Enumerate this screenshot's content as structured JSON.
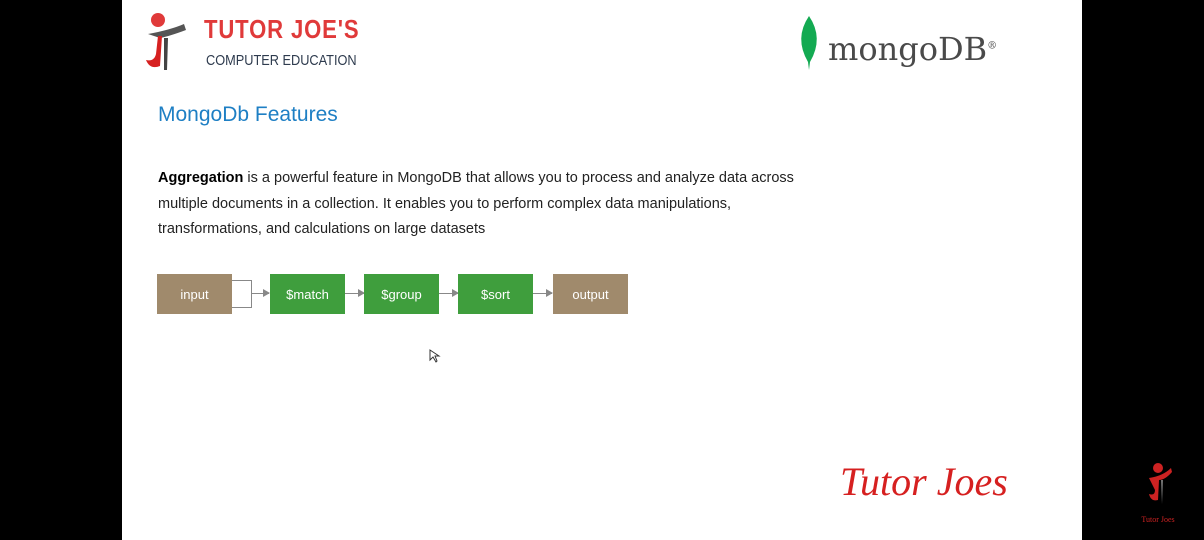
{
  "header": {
    "brand_title": "TUTOR JOE'S",
    "brand_subtitle": "COMPUTER EDUCATION",
    "mongo_logo": "mongoDB"
  },
  "slide": {
    "heading": "MongoDb Features",
    "paragraph_bold": "Aggregation",
    "paragraph_rest": " is a powerful feature in MongoDB that allows you to process and analyze data across multiple documents in a collection. It enables you to perform complex data manipulations, transformations, and calculations on large datasets"
  },
  "pipeline": [
    {
      "label": "input",
      "color": "#a08a6c"
    },
    {
      "label": "$match",
      "color": "#3f9e3d"
    },
    {
      "label": "$group",
      "color": "#3f9e3d"
    },
    {
      "label": "$sort",
      "color": "#3f9e3d"
    },
    {
      "label": "output",
      "color": "#a08a6c"
    }
  ],
  "footer": {
    "signature": "Tutor Joes",
    "watermark": "Tutor Joes"
  },
  "colors": {
    "accent_red": "#e03a3a",
    "heading_blue": "#1e7fc4",
    "mongo_green": "#13aa52"
  }
}
